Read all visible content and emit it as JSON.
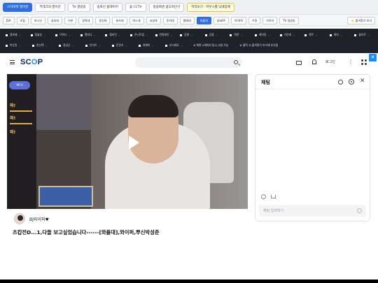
{
  "toolbar_top": {
    "buttons": [
      "스타대학 열이분",
      "키테크의 열이분",
      "TV 생방송",
      "송로신 플레이어",
      "숲 CCTV",
      "방송화면 광고차단기",
      "미리보기 · 마우스를 닉네임에"
    ]
  },
  "toolbar_cats": {
    "buttons": [
      "JSA",
      "조합",
      "하나신",
      "뷰티대",
      "기본",
      "장족대",
      "정신대",
      "놓치대",
      "마느대",
      "서성대",
      "투어대",
      "엘레대",
      "와플대",
      "날씨FA",
      "아이FA",
      "수정",
      "가이아",
      "TV 생방송"
    ],
    "active_index": 12,
    "favorite_label": "⭐ 즐겨찾기 보기"
  },
  "channel_bar": {
    "row1": [
      "랭피혜",
      "정술송",
      "이하나",
      "엘레니",
      "캠비안",
      "온나트빔",
      "반용래인",
      "강향",
      "김중",
      "하한",
      "페치랑",
      "가인래",
      "예주",
      "캐비",
      "블라주"
    ],
    "row2": [
      "박순원",
      "원산택",
      "정성군",
      "빈자트",
      "운준이",
      "최예마",
      "분사예도"
    ],
    "note1": "★ 화면 4개까지 동시 시청 가능",
    "note2": "★ 클릭 시 즐겨찾기 보기에 추가됨"
  },
  "header": {
    "logo_text_pre": "SC",
    "logo_text_mid": "O",
    "logo_text_post": "P",
    "login_label": "로그인",
    "more_glyph": "⋮"
  },
  "close_glyph": "✕",
  "video": {
    "overlay_badge": "WFU",
    "overlay_lines": [
      "와!",
      "와!",
      "와!"
    ]
  },
  "stream": {
    "streamer_name": "BJ와이퍼♥",
    "title": "츠캅전D...1,다들 보고싶었습니다------[와플대],와이퍼,뿌신박성준"
  },
  "chat": {
    "title": "채팅",
    "close_glyph": "✕",
    "input_placeholder": "채팅 입력하기"
  }
}
